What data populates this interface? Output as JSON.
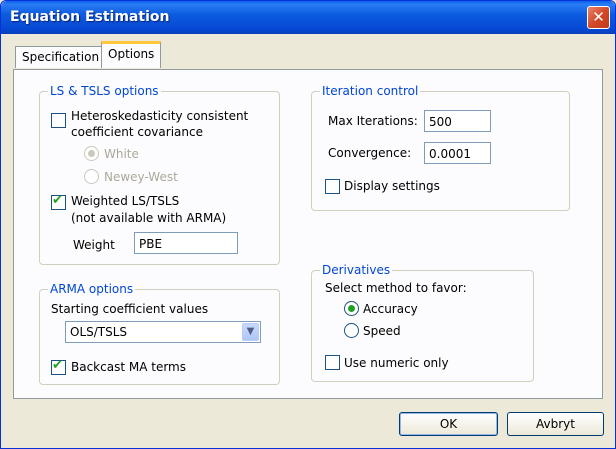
{
  "window": {
    "title": "Equation Estimation",
    "close_label": "✕"
  },
  "tabs": [
    {
      "label": "Specification",
      "active": false
    },
    {
      "label": "Options",
      "active": true
    }
  ],
  "ls_tsls": {
    "legend": "LS & TSLS options",
    "hac_label_1": "Heteroskedasticity consistent",
    "hac_label_2": "coefficient covariance",
    "hac_checked": false,
    "white_label": "White",
    "newey_label": "Newey-West",
    "weighted_label_1": "Weighted LS/TSLS",
    "weighted_label_2": "(not available with ARMA)",
    "weighted_checked": true,
    "weight_label": "Weight",
    "weight_value": "PBE"
  },
  "iteration": {
    "legend": "Iteration control",
    "max_iter_label": "Max Iterations:",
    "max_iter_value": "500",
    "convergence_label": "Convergence:",
    "convergence_value": "0.0001",
    "display_label": "Display settings",
    "display_checked": false
  },
  "arma": {
    "legend": "ARMA options",
    "starting_label": "Starting coefficient values",
    "starting_value": "OLS/TSLS",
    "backcast_label": "Backcast MA terms",
    "backcast_checked": true
  },
  "derivatives": {
    "legend": "Derivatives",
    "favor_label": "Select method to favor:",
    "accuracy_label": "Accuracy",
    "speed_label": "Speed",
    "selected": "Accuracy",
    "numeric_label": "Use numeric only",
    "numeric_checked": false
  },
  "buttons": {
    "ok": "OK",
    "cancel": "Avbryt"
  },
  "colors": {
    "title_bar": "#0a5fe8",
    "legend_text": "#0046d5",
    "check_mark": "#21a121",
    "dialog_bg": "#ece9d8"
  }
}
